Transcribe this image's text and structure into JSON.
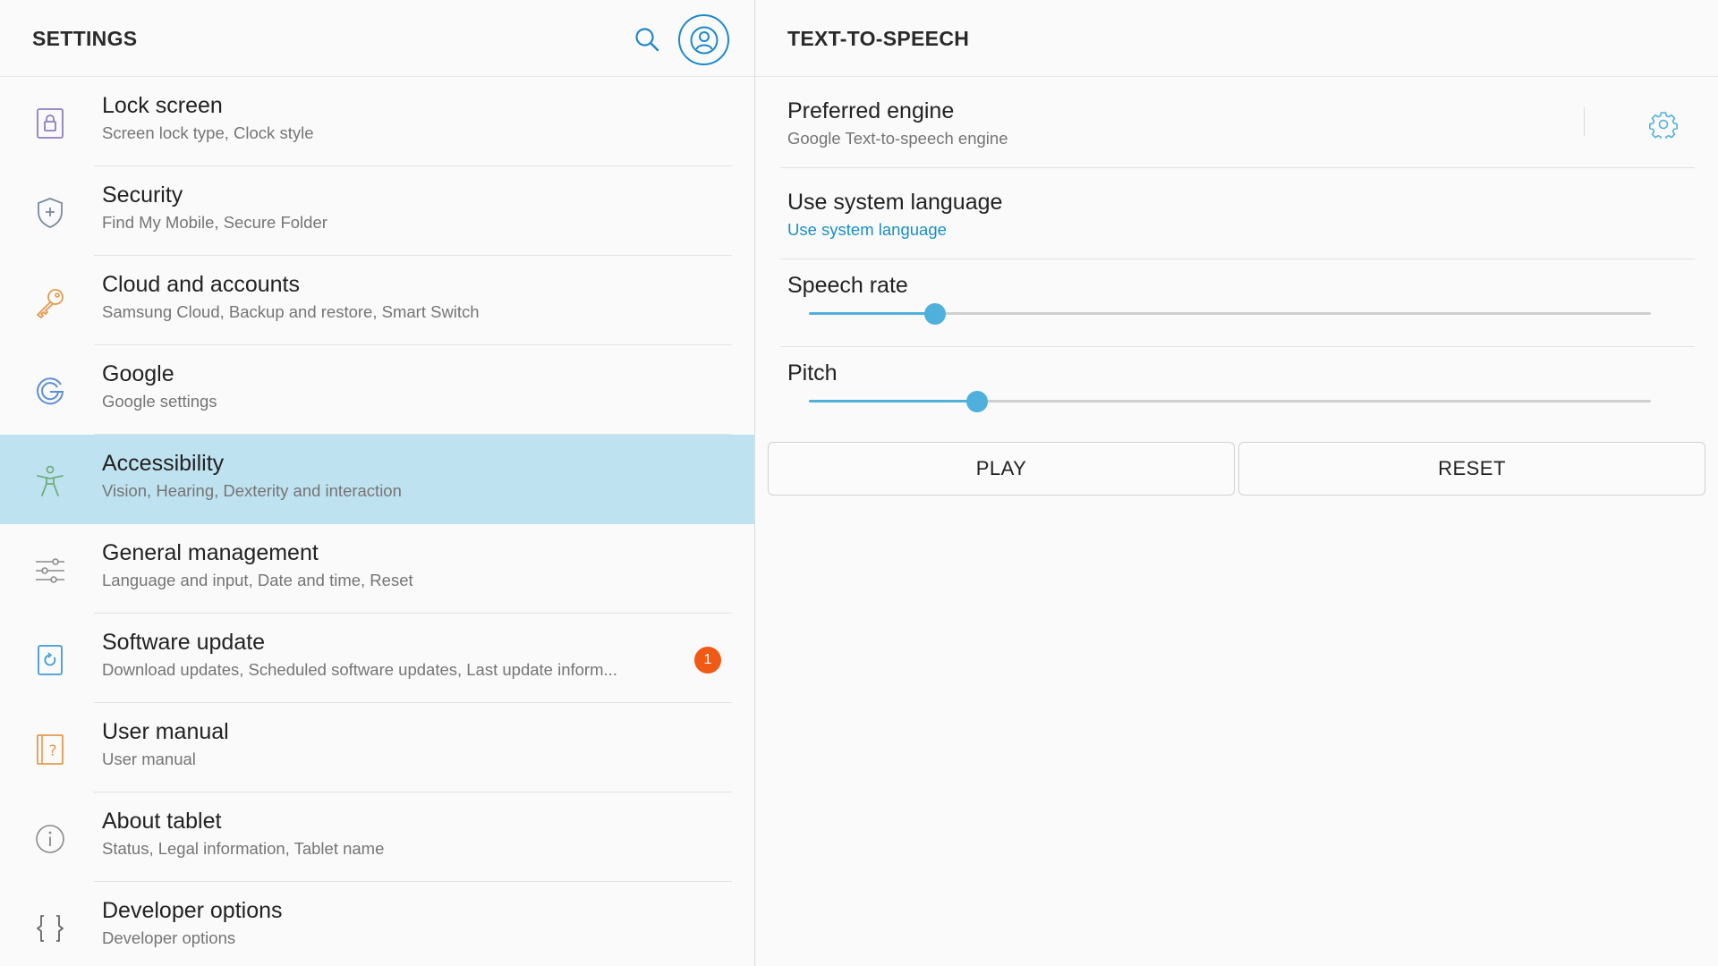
{
  "settings": {
    "title": "SETTINGS",
    "items": [
      {
        "title": "Lock screen",
        "subtitle": "Screen lock type, Clock style",
        "icon": "lock-icon",
        "icon_color": "#8e7cc3"
      },
      {
        "title": "Security",
        "subtitle": "Find My Mobile, Secure Folder",
        "icon": "shield-icon",
        "icon_color": "#7a8aa0"
      },
      {
        "title": "Cloud and accounts",
        "subtitle": "Samsung Cloud, Backup and restore, Smart Switch",
        "icon": "key-icon",
        "icon_color": "#e39a4c"
      },
      {
        "title": "Google",
        "subtitle": "Google settings",
        "icon": "google-icon",
        "icon_color": "#5b8fd6"
      },
      {
        "title": "Accessibility",
        "subtitle": "Vision, Hearing, Dexterity and interaction",
        "icon": "accessibility-icon",
        "icon_color": "#6fae7a",
        "active": true
      },
      {
        "title": "General management",
        "subtitle": "Language and input, Date and time, Reset",
        "icon": "sliders-icon",
        "icon_color": "#8a8a8a"
      },
      {
        "title": "Software update",
        "subtitle": "Download updates, Scheduled software updates, Last update inform...",
        "icon": "update-icon",
        "icon_color": "#3f9bd6",
        "badge": "1"
      },
      {
        "title": "User manual",
        "subtitle": "User manual",
        "icon": "help-book-icon",
        "icon_color": "#e39a4c"
      },
      {
        "title": "About tablet",
        "subtitle": "Status, Legal information, Tablet name",
        "icon": "info-icon",
        "icon_color": "#8a8a8a"
      },
      {
        "title": "Developer options",
        "subtitle": "Developer options",
        "icon": "braces-icon",
        "icon_color": "#666666"
      }
    ]
  },
  "tts": {
    "title": "TEXT-TO-SPEECH",
    "engine": {
      "title": "Preferred engine",
      "subtitle": "Google Text-to-speech engine"
    },
    "language": {
      "title": "Use system language",
      "subtitle": "Use system language"
    },
    "speech_rate": {
      "label": "Speech rate",
      "value": 0.15
    },
    "pitch": {
      "label": "Pitch",
      "value": 0.2
    },
    "play_label": "PLAY",
    "reset_label": "RESET"
  },
  "colors": {
    "accent": "#4fb0dc",
    "selected_row": "#bfe2f0",
    "badge": "#f05a14",
    "link": "#1a8fc4"
  }
}
